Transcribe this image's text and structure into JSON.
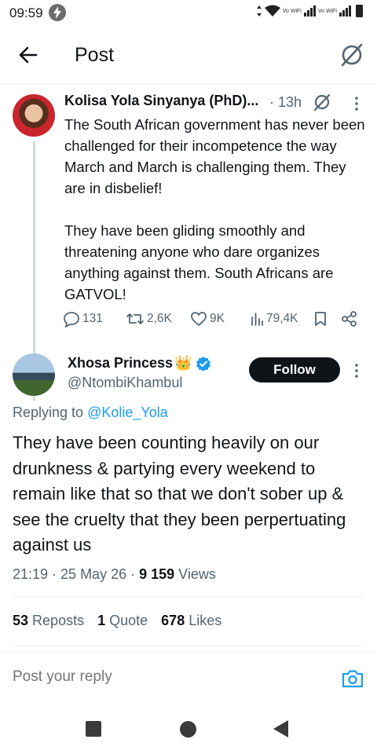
{
  "status_bar": {
    "time": "09:59",
    "vowifi_1": "Vo WiFi",
    "vowifi_2": "Vo WiFi"
  },
  "header": {
    "title": "Post"
  },
  "parent_post": {
    "author_name": "Kolisa Yola Sinyanya (PhD)...",
    "time": "· 13h",
    "paragraph_1": "The South African government has never been challenged for their incompetence the way March and March is challenging them. They are in disbelief!",
    "paragraph_2": "They have been gliding smoothly and threatening anyone who dare organizes anything against them. South Africans are GATVOL!",
    "replies": "131",
    "reposts": "2,6K",
    "likes": "9K",
    "views": "79,4K"
  },
  "reply_post": {
    "author_name": "Xhosa Princess",
    "author_emoji": "👑",
    "handle": "@NtombiKhambul",
    "follow_label": "Follow",
    "replying_prefix": "Replying to",
    "replying_handle": "@Kolie_Yola",
    "text": "They have been counting heavily on our drunkness & partying every weekend to remain like that so that we don't sober up & see the cruelty that they been perpertuating against us",
    "timestamp": "21:19 · 25 May 26 ·",
    "views_count": "9 159",
    "views_label": "Views"
  },
  "stats": {
    "reposts_count": "53",
    "reposts_label": "Reposts",
    "quotes_count": "1",
    "quotes_label": "Quote",
    "likes_count": "678",
    "likes_label": "Likes"
  },
  "reply_bar": {
    "placeholder": "Post your reply"
  },
  "colors": {
    "accent": "#1d9bf0",
    "text": "#0f1419",
    "secondary_text": "#536471",
    "verified": "#1d9bf0"
  }
}
